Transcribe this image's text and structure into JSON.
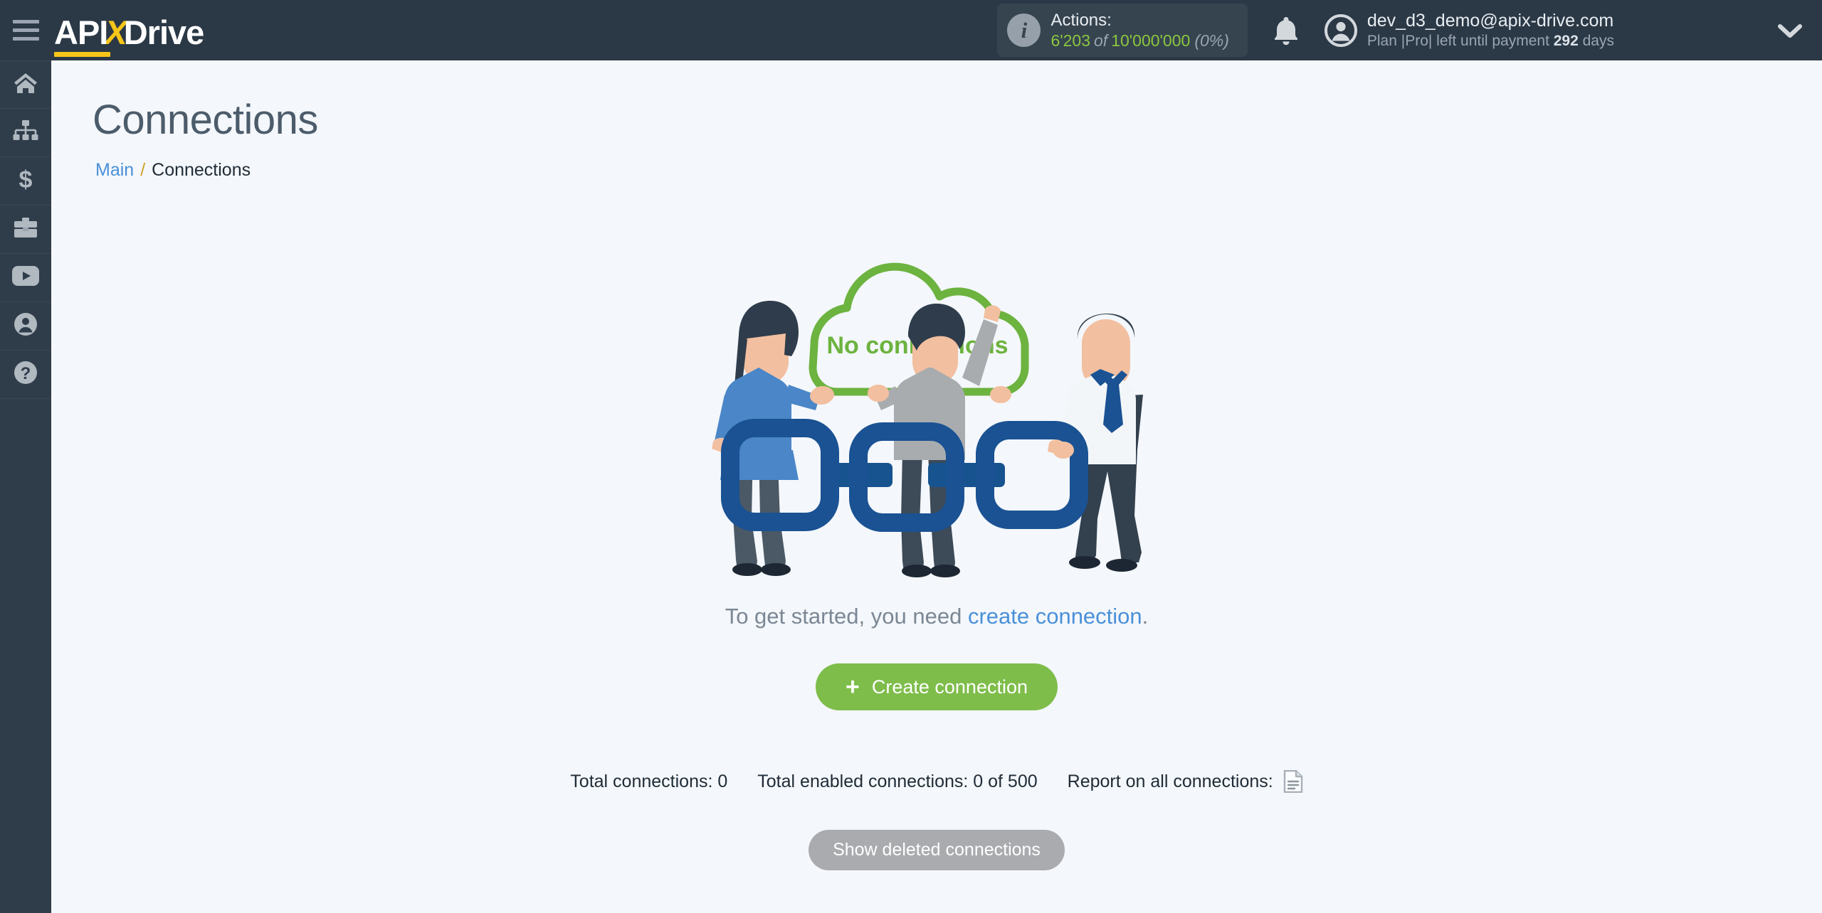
{
  "brand": {
    "logo_part1": "API",
    "logo_x": "X",
    "logo_part2": "Drive",
    "menu_icon": "hamburger-menu-icon"
  },
  "header": {
    "actions": {
      "info_glyph": "i",
      "label": "Actions:",
      "used": "6'203",
      "of": "of",
      "total": "10'000'000",
      "percent": "(0%)"
    },
    "notifications_icon": "bell-icon",
    "user": {
      "email": "dev_d3_demo@apix-drive.com",
      "plan_prefix": "Plan |Pro| left until payment ",
      "plan_days": "292",
      "plan_suffix": " days",
      "avatar_icon": "user-avatar-icon"
    },
    "dropdown_icon": "chevron-down-icon"
  },
  "sidebar": {
    "items": [
      {
        "name": "home",
        "icon": "home-icon"
      },
      {
        "name": "connections",
        "icon": "sitemap-icon"
      },
      {
        "name": "billing",
        "icon": "dollar-icon"
      },
      {
        "name": "partners",
        "icon": "briefcase-icon"
      },
      {
        "name": "video",
        "icon": "youtube-icon"
      },
      {
        "name": "account",
        "icon": "user-circle-icon"
      },
      {
        "name": "help",
        "icon": "question-circle-icon"
      }
    ]
  },
  "page": {
    "title": "Connections",
    "breadcrumb": {
      "root": "Main",
      "separator": "/",
      "current": "Connections"
    }
  },
  "empty_state": {
    "cloud_text": "No connections",
    "lead_prefix": "To get started, you need ",
    "lead_link": "create connection",
    "lead_suffix": ".",
    "create_button": {
      "plus": "+",
      "label": "Create connection"
    },
    "illustration_alt": "three-people-holding-chain-links-illustration"
  },
  "stats": {
    "total_connections": "Total connections: 0",
    "total_enabled": "Total enabled connections: 0 of 500",
    "report_label": "Report on all connections:",
    "report_icon": "document-report-icon"
  },
  "footer_actions": {
    "show_deleted": "Show deleted connections"
  },
  "colors": {
    "header_bg": "#2b3846",
    "sidebar_bg": "#2f3d4b",
    "content_bg": "#f4f7fb",
    "accent_green": "#7ebd4a",
    "accent_yellow": "#f5c518",
    "link_blue": "#4a90d9",
    "chain_blue": "#1a5293",
    "gray_button": "#a9abae"
  }
}
